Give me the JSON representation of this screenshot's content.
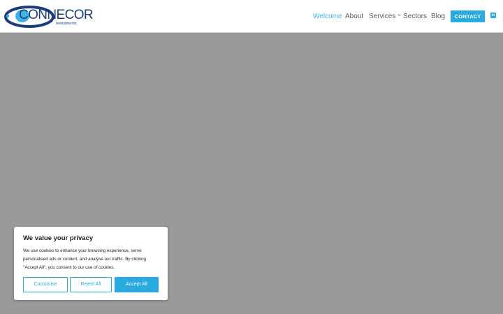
{
  "header": {
    "logo": {
      "name": "CONNECOR",
      "sub": "Investments"
    },
    "nav": [
      {
        "label": "Welcome",
        "active": true
      },
      {
        "label": "About"
      },
      {
        "label": "Services",
        "has_dropdown": true
      },
      {
        "label": "Sectors"
      },
      {
        "label": "Blog"
      }
    ],
    "contact_label": "CONTACT",
    "social_icon": "linkedin-icon",
    "social_glyph": "in"
  },
  "cookie": {
    "title": "We value your privacy",
    "text": "We use cookies to enhance your browsing experience, serve personalised ads or content, and analyse our traffic. By clicking \"Accept All\", you consent to our use of cookies.",
    "customise_label": "Customise",
    "reject_label": "Reject All",
    "accept_label": "Accept All"
  },
  "colors": {
    "accent": "#29abe2",
    "brand_navy": "#1c3d7a",
    "overlay": "#9a9a9a",
    "nav_text": "#5a5a5a",
    "nav_active": "#3fb3e3"
  }
}
